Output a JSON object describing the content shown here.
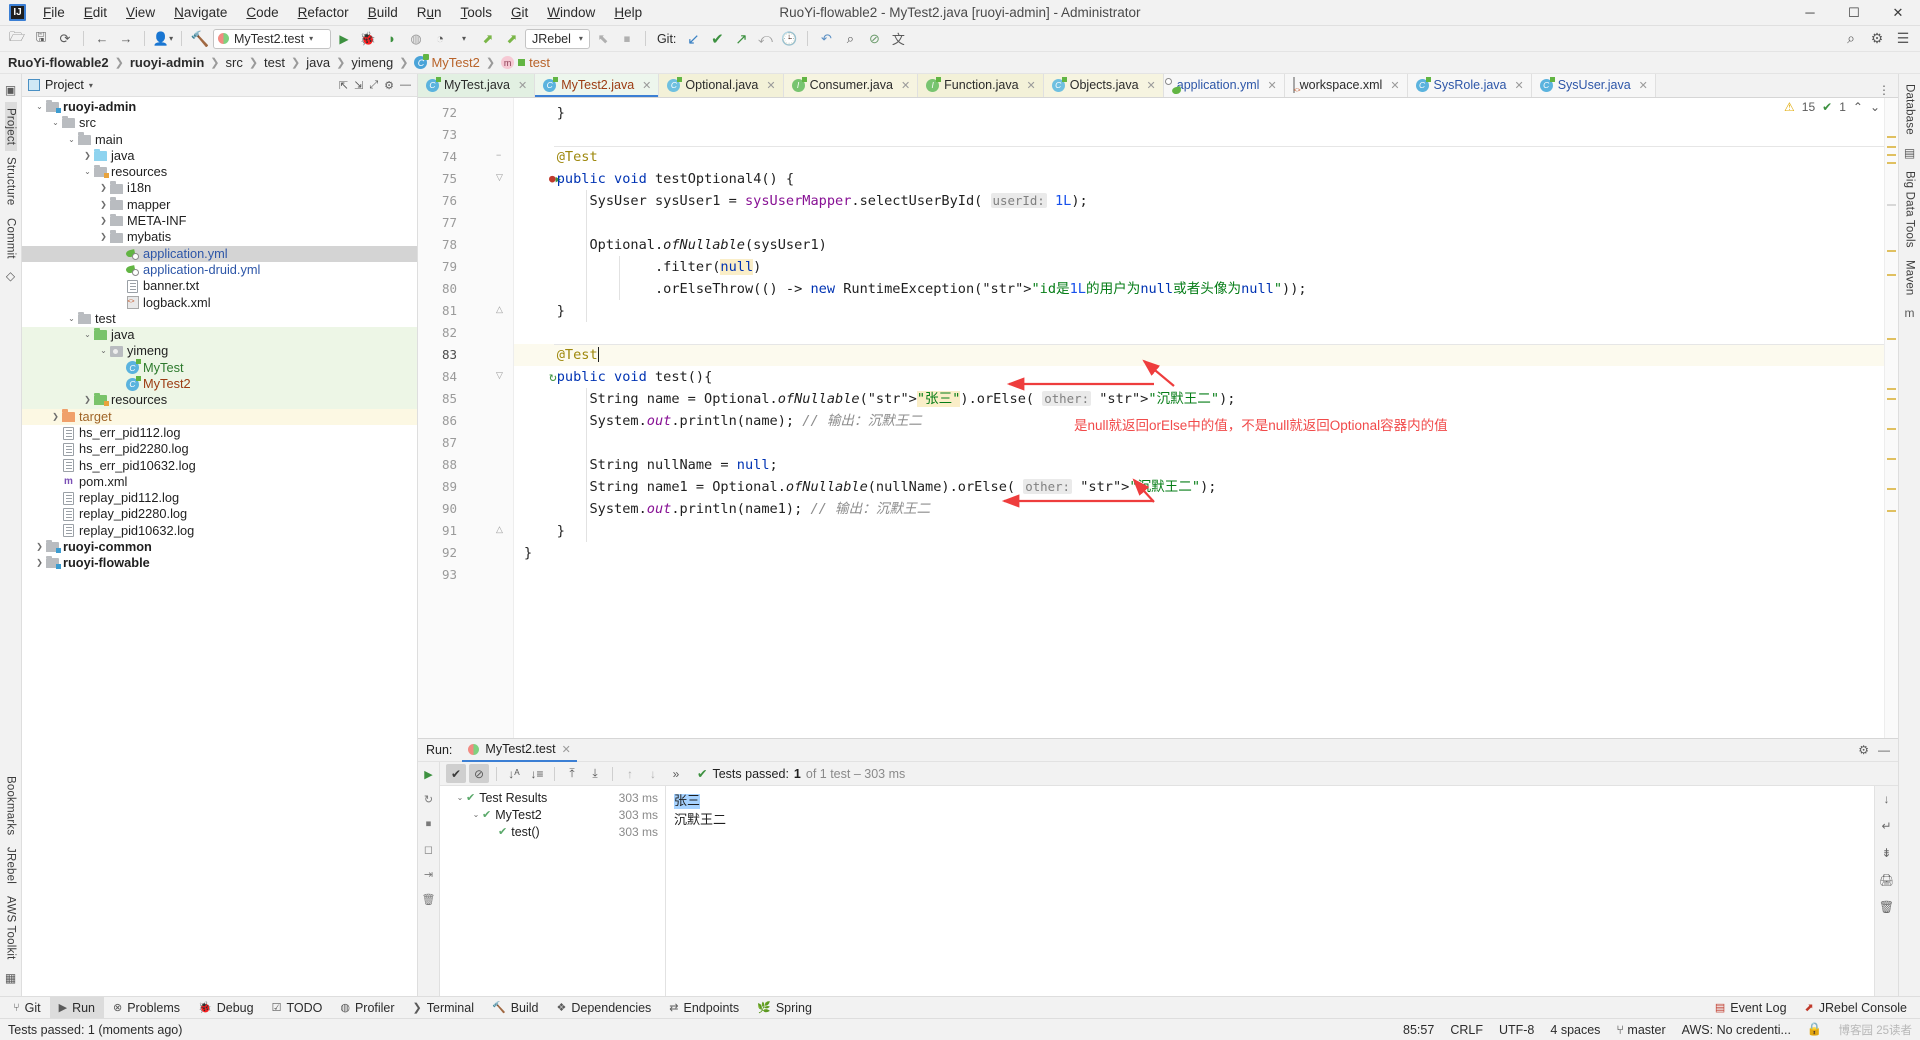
{
  "window": {
    "title": "RuoYi-flowable2 - MyTest2.java [ruoyi-admin] - Administrator",
    "minimize": "─",
    "maximize": "☐",
    "close": "✕"
  },
  "menu": [
    "File",
    "Edit",
    "View",
    "Navigate",
    "Code",
    "Refactor",
    "Build",
    "Run",
    "Tools",
    "Git",
    "Window",
    "Help"
  ],
  "toolbar": {
    "open_icon": "open-folder-icon",
    "save_icon": "save-icon",
    "sync_icon": "sync-icon",
    "back_icon": "back-arrow-icon",
    "forward_icon": "forward-arrow-icon",
    "profile_icon": "user-profile-icon",
    "build_icon": "build-hammer-icon",
    "run_config": "MyTest2.test",
    "run_icon": "run-icon",
    "debug_icon": "debug-icon",
    "run_coverage_icon": "run-with-coverage-icon",
    "profiler_icon": "profiler-icon",
    "jrebel_select": "JRebel",
    "git_label": "Git:",
    "git_update": "update-project-icon",
    "git_commit": "commit-icon",
    "git_push": "push-icon",
    "git_rollback": "rollback-icon",
    "history_icon": "history-icon",
    "undo_icon": "undo-icon",
    "search_icon": "search-everywhere-icon",
    "settings_icon": "settings-gear-icon",
    "help_icon": "help-icon",
    "stop_icon": "stop-icon",
    "translate_icon": "translate-icon"
  },
  "breadcrumb": [
    {
      "text": "RuoYi-flowable2",
      "style": "bold"
    },
    {
      "text": "ruoyi-admin",
      "style": "bold"
    },
    {
      "text": "src",
      "style": "plain"
    },
    {
      "text": "test",
      "style": "plain"
    },
    {
      "text": "java",
      "style": "plain"
    },
    {
      "text": "yimeng",
      "style": "plain"
    },
    {
      "text": "MyTest2",
      "style": "class"
    },
    {
      "text": "test",
      "style": "method"
    }
  ],
  "left_rail": {
    "project": "Project",
    "structure": "Structure",
    "commit": "Commit",
    "bookmarks": "Bookmarks",
    "jrebel": "JRebel",
    "aws_toolkit": "AWS Toolkit"
  },
  "right_rail": {
    "database": "Database",
    "big_data_tools": "Big Data Tools",
    "maven": "Maven"
  },
  "project_panel": {
    "title": "Project",
    "tree": [
      {
        "depth": 0,
        "arrow": "v",
        "icon": "module-folder",
        "label": "ruoyi-admin",
        "style": "bold",
        "row": "plain"
      },
      {
        "depth": 1,
        "arrow": "v",
        "icon": "folder",
        "label": "src",
        "style": "plain",
        "row": "plain"
      },
      {
        "depth": 2,
        "arrow": "v",
        "icon": "folder",
        "label": "main",
        "style": "plain",
        "row": "plain"
      },
      {
        "depth": 3,
        "arrow": ">",
        "icon": "folder-src-blue",
        "label": "java",
        "style": "plain",
        "row": "plain"
      },
      {
        "depth": 3,
        "arrow": "v",
        "icon": "folder-resource",
        "label": "resources",
        "style": "plain",
        "row": "plain"
      },
      {
        "depth": 4,
        "arrow": ">",
        "icon": "folder",
        "label": "i18n",
        "style": "plain",
        "row": "plain"
      },
      {
        "depth": 4,
        "arrow": ">",
        "icon": "folder",
        "label": "mapper",
        "style": "plain",
        "row": "plain"
      },
      {
        "depth": 4,
        "arrow": ">",
        "icon": "folder",
        "label": "META-INF",
        "style": "plain",
        "row": "plain"
      },
      {
        "depth": 4,
        "arrow": ">",
        "icon": "folder",
        "label": "mybatis",
        "style": "plain",
        "row": "plain"
      },
      {
        "depth": 5,
        "arrow": "",
        "icon": "yml-file",
        "label": "application.yml",
        "style": "blue",
        "row": "selected"
      },
      {
        "depth": 5,
        "arrow": "",
        "icon": "yml-file",
        "label": "application-druid.yml",
        "style": "blue",
        "row": "plain"
      },
      {
        "depth": 5,
        "arrow": "",
        "icon": "text-file",
        "label": "banner.txt",
        "style": "dark",
        "row": "plain"
      },
      {
        "depth": 5,
        "arrow": "",
        "icon": "xml-file",
        "label": "logback.xml",
        "style": "dark",
        "row": "plain"
      },
      {
        "depth": 2,
        "arrow": "v",
        "icon": "folder",
        "label": "test",
        "style": "plain",
        "row": "plain"
      },
      {
        "depth": 3,
        "arrow": "v",
        "icon": "folder-test-green",
        "label": "java",
        "style": "plain",
        "row": "green"
      },
      {
        "depth": 4,
        "arrow": "v",
        "icon": "package",
        "label": "yimeng",
        "style": "plain",
        "row": "green"
      },
      {
        "depth": 5,
        "arrow": "",
        "icon": "java-class",
        "label": "MyTest",
        "style": "green",
        "row": "green"
      },
      {
        "depth": 5,
        "arrow": "",
        "icon": "java-class",
        "label": "MyTest2",
        "style": "brown",
        "row": "green"
      },
      {
        "depth": 3,
        "arrow": ">",
        "icon": "folder-testres",
        "label": "resources",
        "style": "plain",
        "row": "green"
      },
      {
        "depth": 1,
        "arrow": ">",
        "icon": "folder-target",
        "label": "target",
        "style": "orange",
        "row": "yellow"
      },
      {
        "depth": 1,
        "arrow": "",
        "icon": "text-file",
        "label": "hs_err_pid112.log",
        "style": "dark",
        "row": "plain"
      },
      {
        "depth": 1,
        "arrow": "",
        "icon": "text-file",
        "label": "hs_err_pid2280.log",
        "style": "dark",
        "row": "plain"
      },
      {
        "depth": 1,
        "arrow": "",
        "icon": "text-file",
        "label": "hs_err_pid10632.log",
        "style": "dark",
        "row": "plain"
      },
      {
        "depth": 1,
        "arrow": "",
        "icon": "maven-file",
        "label": "pom.xml",
        "style": "dark",
        "row": "plain"
      },
      {
        "depth": 1,
        "arrow": "",
        "icon": "text-file",
        "label": "replay_pid112.log",
        "style": "dark",
        "row": "plain"
      },
      {
        "depth": 1,
        "arrow": "",
        "icon": "text-file",
        "label": "replay_pid2280.log",
        "style": "dark",
        "row": "plain"
      },
      {
        "depth": 1,
        "arrow": "",
        "icon": "text-file",
        "label": "replay_pid10632.log",
        "style": "dark",
        "row": "plain"
      },
      {
        "depth": 0,
        "arrow": ">",
        "icon": "module-folder",
        "label": "ruoyi-common",
        "style": "bold",
        "row": "plain"
      },
      {
        "depth": 0,
        "arrow": ">",
        "icon": "module-folder",
        "label": "ruoyi-flowable",
        "style": "bold",
        "row": "plain"
      }
    ]
  },
  "editor_tabs": [
    {
      "label": "MyTest.java",
      "icon": "java-class-icon",
      "bg": "g1",
      "color": "dark",
      "active": false
    },
    {
      "label": "MyTest2.java",
      "icon": "java-class-icon",
      "bg": "g2",
      "color": "brown",
      "active": true
    },
    {
      "label": "Optional.java",
      "icon": "java-lib-icon",
      "bg": "y1",
      "color": "dark",
      "active": false
    },
    {
      "label": "Consumer.java",
      "icon": "java-intf-icon",
      "bg": "y2",
      "color": "dark",
      "active": false
    },
    {
      "label": "Function.java",
      "icon": "java-intf-icon",
      "bg": "y1",
      "color": "dark",
      "active": false
    },
    {
      "label": "Objects.java",
      "icon": "java-lib-icon",
      "bg": "y2",
      "color": "dark",
      "active": false
    },
    {
      "label": "application.yml",
      "icon": "yml-file-icon",
      "bg": "plain",
      "color": "blue",
      "active": false
    },
    {
      "label": "workspace.xml",
      "icon": "xml-file-icon",
      "bg": "plain",
      "color": "dark",
      "active": false
    },
    {
      "label": "SysRole.java",
      "icon": "java-class-icon",
      "bg": "plain",
      "color": "blue",
      "active": false
    },
    {
      "label": "SysUser.java",
      "icon": "java-class-icon",
      "bg": "plain",
      "color": "blue",
      "active": false
    }
  ],
  "inspections": {
    "warnings": "15",
    "checks": "1",
    "warn_icon": "warning-triangle-icon",
    "ok_icon": "check-icon"
  },
  "code": {
    "first_line": 72,
    "current_line": 83,
    "lines": [
      {
        "n": 72,
        "text": "    }"
      },
      {
        "n": 73,
        "text": ""
      },
      {
        "n": 74,
        "text": "    @Test"
      },
      {
        "n": 75,
        "text": "    public void testOptional4() {"
      },
      {
        "n": 76,
        "text": "        SysUser sysUser1 = sysUserMapper.selectUserById( userId: 1L);"
      },
      {
        "n": 77,
        "text": ""
      },
      {
        "n": 78,
        "text": "        Optional.ofNullable(sysUser1)"
      },
      {
        "n": 79,
        "text": "                .filter(null)"
      },
      {
        "n": 80,
        "text": "                .orElseThrow(() -> new RuntimeException(\"id是1L的用户为null或者头像为null\"));"
      },
      {
        "n": 81,
        "text": "    }"
      },
      {
        "n": 82,
        "text": ""
      },
      {
        "n": 83,
        "text": "    @Test"
      },
      {
        "n": 84,
        "text": "    public void test(){"
      },
      {
        "n": 85,
        "text": "        String name = Optional.ofNullable(\"张三\").orElse( other: \"沉默王二\");"
      },
      {
        "n": 86,
        "text": "        System.out.println(name); // 输出：沉默王二"
      },
      {
        "n": 87,
        "text": ""
      },
      {
        "n": 88,
        "text": "        String nullName = null;"
      },
      {
        "n": 89,
        "text": "        String name1 = Optional.ofNullable(nullName).orElse( other: \"沉默王二\");"
      },
      {
        "n": 90,
        "text": "        System.out.println(name1); // 输出：沉默王二"
      },
      {
        "n": 91,
        "text": "    }"
      },
      {
        "n": 92,
        "text": "}"
      },
      {
        "n": 93,
        "text": ""
      }
    ],
    "gutter_marks": [
      {
        "line": 75,
        "icon": "run-test-failed-icon"
      },
      {
        "line": 84,
        "icon": "run-test-rerun-icon"
      }
    ],
    "annotation": "是null就返回orElse中的值，不是null就返回Optional容器内的值",
    "annotation_color": "#f14a4a"
  },
  "run_panel": {
    "label": "Run:",
    "tab": "MyTest2.test",
    "tab_close": "✕",
    "toolbar": {
      "rerun_icon": "rerun-icon",
      "show_passed_icon": "show-passed-icon",
      "show_ignored_icon": "show-ignored-icon",
      "sort_alpha_icon": "sort-alphabetically-icon",
      "sort_duration_icon": "sort-by-duration-icon",
      "expand_icon": "expand-all-icon",
      "collapse_icon": "collapse-all-icon",
      "prev_icon": "previous-failed-icon",
      "next_icon": "next-failed-icon",
      "more_icon": "more-options-icon"
    },
    "status_prefix": "Tests passed:",
    "status_count": "1",
    "status_suffix": "of 1 test – 303 ms",
    "tree": [
      {
        "depth": 0,
        "arrow": "v",
        "label": "Test Results",
        "time": "303 ms"
      },
      {
        "depth": 1,
        "arrow": "v",
        "label": "MyTest2",
        "time": "303 ms"
      },
      {
        "depth": 2,
        "arrow": "",
        "label": "test()",
        "time": "303 ms"
      }
    ],
    "console": [
      {
        "text": "张三",
        "selected": true
      },
      {
        "text": "沉默王二",
        "selected": false
      }
    ],
    "settings_icon": "settings-gear-icon",
    "hide_icon": "hide-panel-icon"
  },
  "tool_windows": [
    {
      "label": "Git",
      "icon": "git-icon",
      "active": false
    },
    {
      "label": "Run",
      "icon": "run-icon",
      "active": true
    },
    {
      "label": "Problems",
      "icon": "problems-icon",
      "active": false
    },
    {
      "label": "Debug",
      "icon": "debug-icon",
      "active": false
    },
    {
      "label": "TODO",
      "icon": "todo-icon",
      "active": false
    },
    {
      "label": "Profiler",
      "icon": "profiler-icon",
      "active": false
    },
    {
      "label": "Terminal",
      "icon": "terminal-icon",
      "active": false
    },
    {
      "label": "Build",
      "icon": "build-icon",
      "active": false
    },
    {
      "label": "Dependencies",
      "icon": "dependencies-icon",
      "active": false
    },
    {
      "label": "Endpoints",
      "icon": "endpoints-icon",
      "active": false
    },
    {
      "label": "Spring",
      "icon": "spring-icon",
      "active": false
    }
  ],
  "tool_windows_right": [
    {
      "label": "Event Log",
      "icon": "event-log-icon"
    },
    {
      "label": "JRebel Console",
      "icon": "jrebel-icon"
    }
  ],
  "status_bar": {
    "message": "Tests passed: 1 (moments ago)",
    "caret": "85:57",
    "line_sep": "CRLF",
    "encoding": "UTF-8",
    "indent": "4 spaces",
    "branch": "master",
    "branch_icon": "branch-icon",
    "aws": "AWS: No credenti...",
    "lock_icon": "lock-icon",
    "watermark": "博客园 25读者"
  }
}
